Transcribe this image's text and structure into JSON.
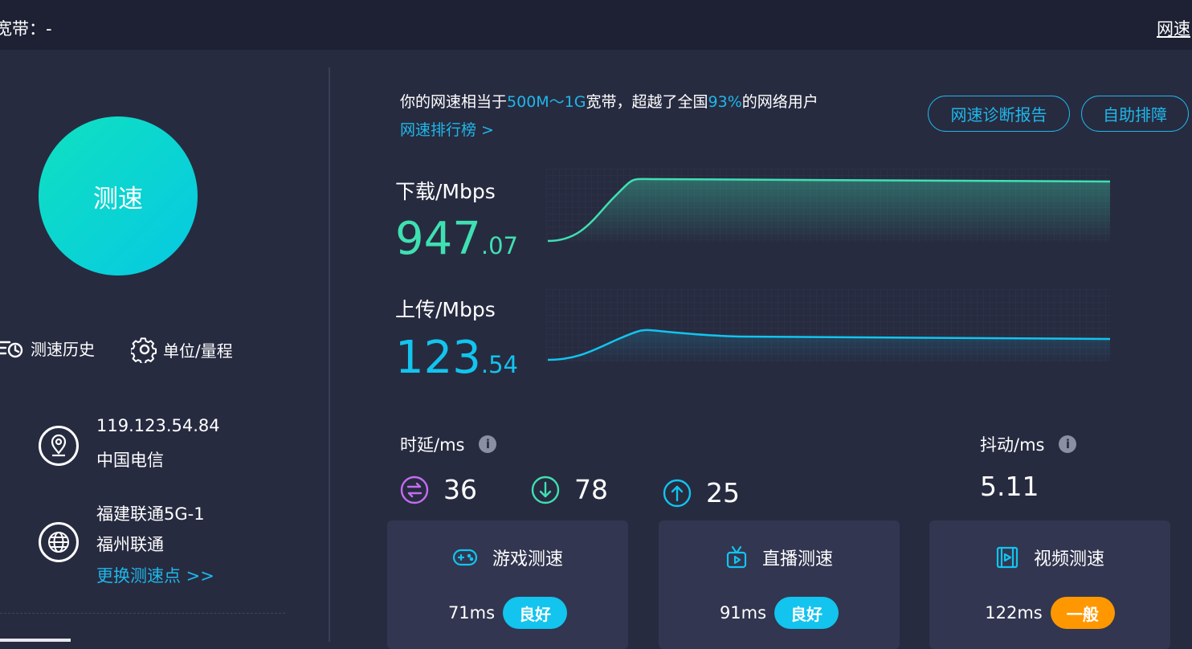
{
  "topbar": {
    "broadband_label": "宽带：-",
    "right_link": "网速"
  },
  "speed_button": {
    "label": "测速"
  },
  "tools": {
    "history_label": "测速历史",
    "settings_label": "单位/量程"
  },
  "ip_info": {
    "ip": "119.123.54.84",
    "isp": "中国电信"
  },
  "server_info": {
    "server_name": "福建联通5G-1",
    "server_isp": "福州联通",
    "change_link": "更换测速点 >>"
  },
  "summary": {
    "prefix": "你的网速相当于",
    "bandwidth": "500M～1G",
    "mid": "宽带，超越了全国",
    "percent": "93%",
    "suffix": "的网络用户",
    "rank_link": "网速排行榜 >"
  },
  "actions": {
    "report_button": "网速诊断报告",
    "troubleshoot_button": "自助排障"
  },
  "download": {
    "label": "下载/Mbps",
    "int": "947",
    "dec": ".07",
    "color": "#3fe0b2"
  },
  "upload": {
    "label": "上传/Mbps",
    "int": "123",
    "dec": ".54",
    "color": "#12c4ee"
  },
  "latency": {
    "label": "时延/ms",
    "idle": "36",
    "download": "78",
    "upload": "25",
    "idle_color": "#c46df0",
    "download_color": "#3fe0b2",
    "upload_color": "#12c4ee"
  },
  "jitter": {
    "label": "抖动/ms",
    "value": "5.11"
  },
  "cards": [
    {
      "title": "游戏测速",
      "value": "71ms",
      "badge": "良好",
      "badge_color": "#12c4ee",
      "icon": "gamepad-icon"
    },
    {
      "title": "直播测速",
      "value": "91ms",
      "badge": "良好",
      "badge_color": "#12c4ee",
      "icon": "tv-icon"
    },
    {
      "title": "视频测速",
      "value": "122ms",
      "badge": "一般",
      "badge_color": "#ff9800",
      "icon": "video-icon"
    }
  ],
  "info_icon_char": "i"
}
